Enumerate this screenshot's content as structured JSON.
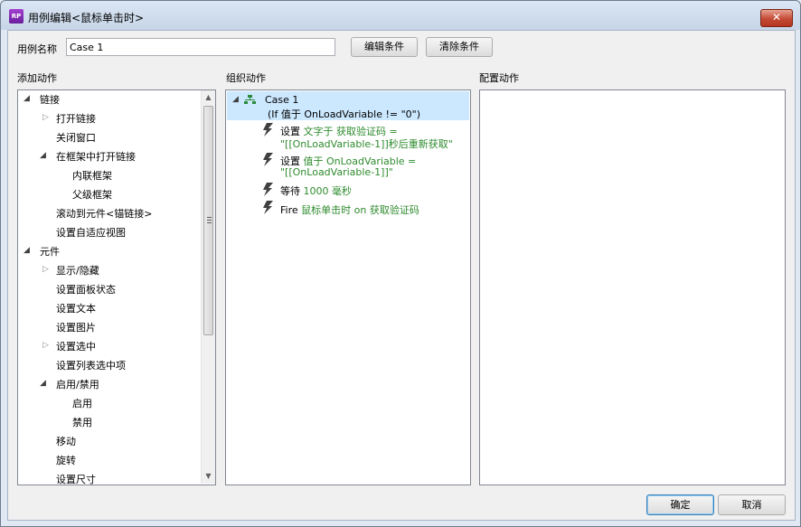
{
  "window": {
    "app_icon_text": "RP",
    "title": "用例编辑<鼠标单击时>",
    "close_label": "✕"
  },
  "header": {
    "case_name_label": "用例名称",
    "case_name_value": "Case 1",
    "edit_conditions_label": "编辑条件",
    "clear_conditions_label": "清除条件"
  },
  "columns": {
    "add_actions": "添加动作",
    "organize_actions": "组织动作",
    "configure_action": "配置动作"
  },
  "actions_tree": {
    "links": "链接",
    "open_link": "打开链接",
    "close_window": "关闭窗口",
    "open_link_in_frame": "在框架中打开链接",
    "inline_frame": "内联框架",
    "parent_frame": "父级框架",
    "scroll_to_widget": "滚动到元件<锚链接>",
    "set_adaptive_view": "设置自适应视图",
    "widgets": "元件",
    "show_hide": "显示/隐藏",
    "set_panel_state": "设置面板状态",
    "set_text": "设置文本",
    "set_image": "设置图片",
    "set_selected": "设置选中",
    "set_list_selection": "设置列表选中项",
    "enable_disable": "启用/禁用",
    "enable": "启用",
    "disable": "禁用",
    "move": "移动",
    "rotate": "旋转",
    "set_size": "设置尺寸"
  },
  "organize": {
    "case_title": "Case 1",
    "case_condition": "(If 值于 OnLoadVariable != \"0\")",
    "actions": [
      {
        "verb": "设置",
        "detail_line1": "文字于 获取验证码 =",
        "detail_line2": "\"[[OnLoadVariable-1]]秒后重新获取\""
      },
      {
        "verb": "设置",
        "detail_line1": "值于 OnLoadVariable =",
        "detail_line2": "\"[[OnLoadVariable-1]]\""
      },
      {
        "verb": "等待",
        "detail_line1": "1000 毫秒",
        "detail_line2": ""
      },
      {
        "verb": "Fire",
        "detail_line1": "鼠标单击时 on 获取验证码",
        "detail_line2": ""
      }
    ]
  },
  "footer": {
    "ok_label": "确定",
    "cancel_label": "取消"
  }
}
